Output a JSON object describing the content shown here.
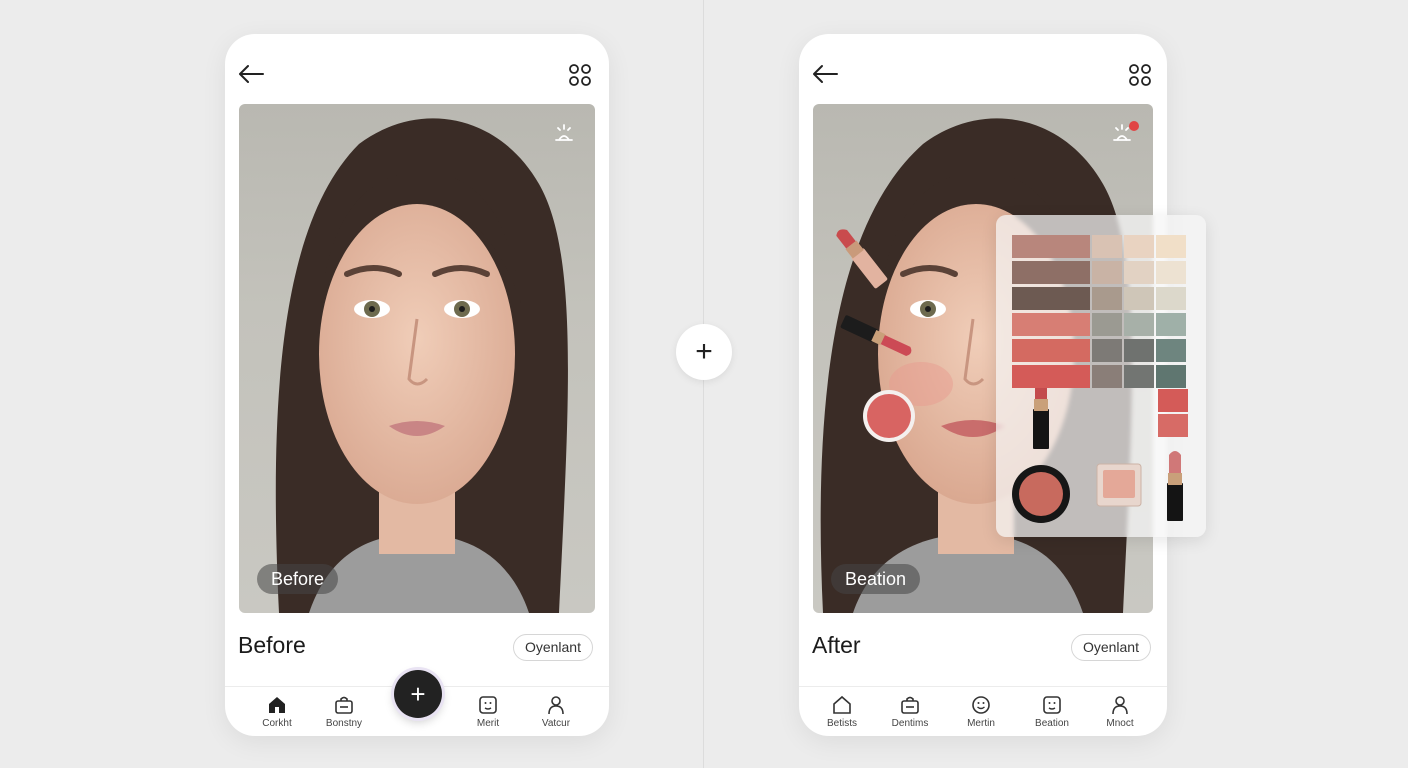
{
  "compare_icon": "plus-icon",
  "before": {
    "chip": "Before",
    "title": "Before",
    "pill": "Oyenlant",
    "nav": [
      {
        "label": "Corkht",
        "icon": "home-icon"
      },
      {
        "label": "Bonstny",
        "icon": "bag-icon"
      },
      {
        "label": "Merit",
        "icon": "face-scan-icon"
      },
      {
        "label": "Vatcur",
        "icon": "profile-icon"
      }
    ],
    "fab": "+"
  },
  "after": {
    "chip": "Beation",
    "title": "After",
    "pill": "Oyenlant",
    "nav": [
      {
        "label": "Betists",
        "icon": "home-icon"
      },
      {
        "label": "Dentims",
        "icon": "bag-icon"
      },
      {
        "label": "Mertin",
        "icon": "smiley-icon"
      },
      {
        "label": "Beation",
        "icon": "face-scan-icon"
      },
      {
        "label": "Mnoct",
        "icon": "profile-icon"
      }
    ]
  },
  "colors": {
    "accent": "#222222",
    "notification": "#e04545",
    "blush": "#d86462",
    "lipstick": "#c8504f"
  },
  "palette_swatches": [
    [
      "#b8867c",
      "#d9c2b3",
      "#e9d3c1",
      "#f1dfc8"
    ],
    [
      "#8e6f66",
      "#c9b3a5",
      "#e2d2c3",
      "#ede2d2"
    ],
    [
      "#6d5a52",
      "#a99a8d",
      "#cfc6b8",
      "#dcd8cb"
    ],
    [
      "#d77e74",
      "#9b9a92",
      "#a7b0a8",
      "#9fb0a8"
    ],
    [
      "#d46a61",
      "#7d7a76",
      "#6f726f",
      "#6e857f"
    ],
    [
      "#d45b58",
      "#8a7e78",
      "#727572",
      "#5f7670"
    ]
  ]
}
